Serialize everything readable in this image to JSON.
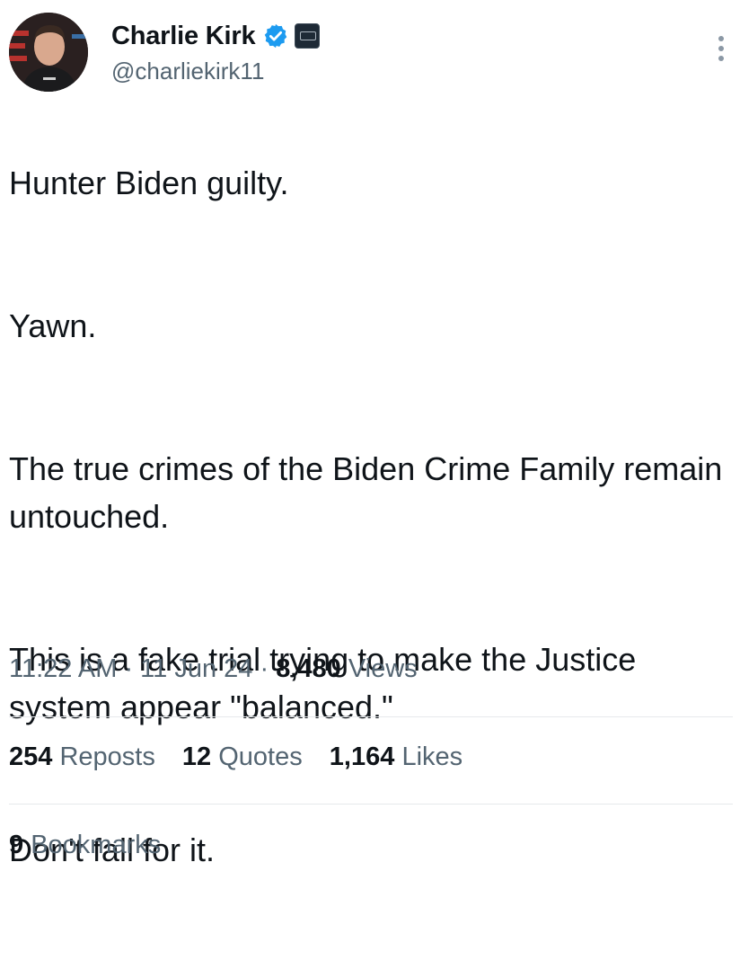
{
  "author": {
    "display_name": "Charlie Kirk",
    "handle": "@charliekirk11",
    "verified": true,
    "avatar_icon": "profile-photo",
    "verified_color": "#1d9bf0"
  },
  "tweet": {
    "paragraphs": [
      "Hunter Biden guilty.",
      "Yawn.",
      "The true crimes of the Biden Crime Family remain untouched.",
      "This is a fake trial trying to make the Justice system appear \"balanced.\"",
      "Don't fall for it."
    ]
  },
  "meta": {
    "time": "11:22 AM",
    "separator": " · ",
    "date": "11 Jun 24",
    "views_count": "8,480",
    "views_label": "Views"
  },
  "stats": {
    "reposts_count": "254",
    "reposts_label": "Reposts",
    "quotes_count": "12",
    "quotes_label": "Quotes",
    "likes_count": "1,164",
    "likes_label": "Likes",
    "bookmarks_count": "9",
    "bookmarks_label": "Bookmarks"
  },
  "colors": {
    "text_primary": "#0f1419",
    "text_secondary": "#536471",
    "divider": "#e6e9ec"
  }
}
